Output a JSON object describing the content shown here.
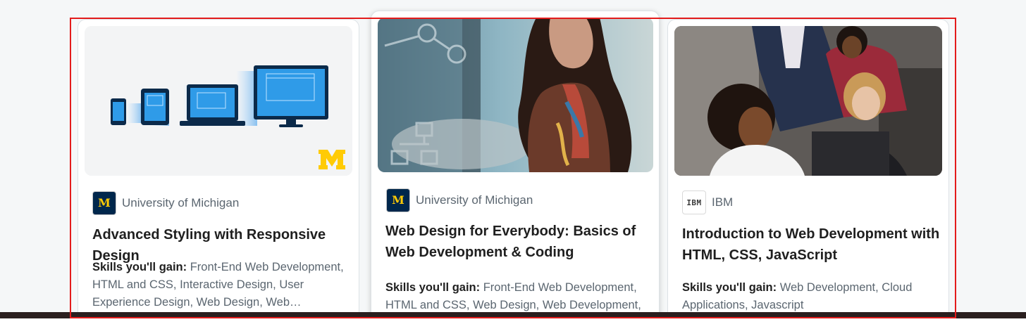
{
  "cards": [
    {
      "partner": "University of Michigan",
      "partner_logo": "university-of-michigan-logo",
      "title": "Advanced Styling with Responsive Design",
      "skills_label": "Skills you'll gain:",
      "skills": "Front-End Web Development, HTML and CSS, Interactive Design, User Experience Design, Web Design, Web…"
    },
    {
      "partner": "University of Michigan",
      "partner_logo": "university-of-michigan-logo",
      "title": "Web Design for Everybody: Basics of Web Development & Coding",
      "skills_label": "Skills you'll gain:",
      "skills": "Front-End Web Development, HTML and CSS, Web Design, Web Development,"
    },
    {
      "partner": "IBM",
      "partner_logo": "ibm-logo",
      "title": "Introduction to Web Development with HTML, CSS, JavaScript",
      "skills_label": "Skills you'll gain:",
      "skills": "Web Development, Cloud Applications, Javascript"
    }
  ],
  "logos": {
    "um_letter": "M",
    "ibm_text": "IBM"
  },
  "colors": {
    "um_navy": "#00274c",
    "um_maize": "#ffcb05",
    "highlight": "#e31b1b",
    "device_blue": "#1e88e5"
  }
}
